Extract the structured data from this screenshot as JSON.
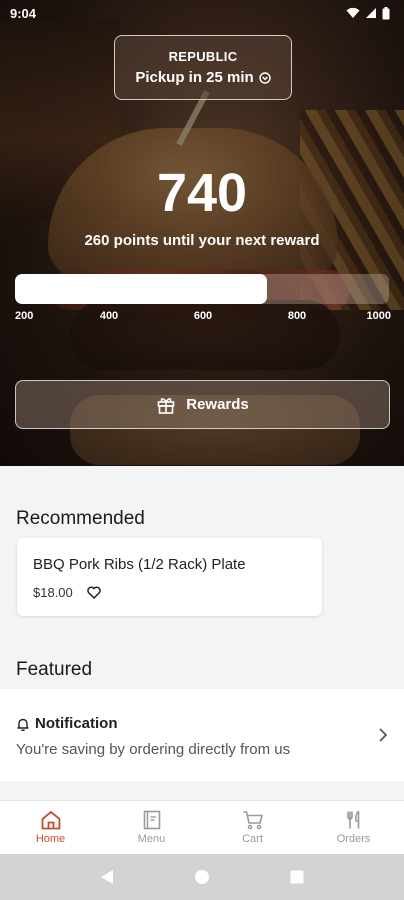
{
  "status_bar": {
    "time": "9:04"
  },
  "location": {
    "name": "REPUBLIC",
    "pickup_text": "Pickup in 25 min"
  },
  "rewards": {
    "points": "740",
    "caption": "260 points until your next reward",
    "progress": {
      "min": 200,
      "max": 1000,
      "value": 740
    },
    "tick_labels": [
      "200",
      "400",
      "600",
      "800",
      "1000"
    ],
    "button_label": "Rewards"
  },
  "recommended": {
    "title": "Recommended",
    "items": [
      {
        "name": "BBQ Pork Ribs (1/2 Rack) Plate",
        "price": "$18.00"
      }
    ]
  },
  "featured": {
    "title": "Featured",
    "notification": {
      "title": "Notification",
      "body": "You're saving by ordering directly from us"
    }
  },
  "nav": {
    "items": [
      {
        "label": "Home",
        "icon": "home-icon",
        "active": true
      },
      {
        "label": "Menu",
        "icon": "menu-book-icon",
        "active": false
      },
      {
        "label": "Cart",
        "icon": "cart-icon",
        "active": false
      },
      {
        "label": "Orders",
        "icon": "fork-knife-icon",
        "active": false
      }
    ]
  },
  "colors": {
    "accent": "#c2502c",
    "inactive": "#9a9a9a"
  }
}
